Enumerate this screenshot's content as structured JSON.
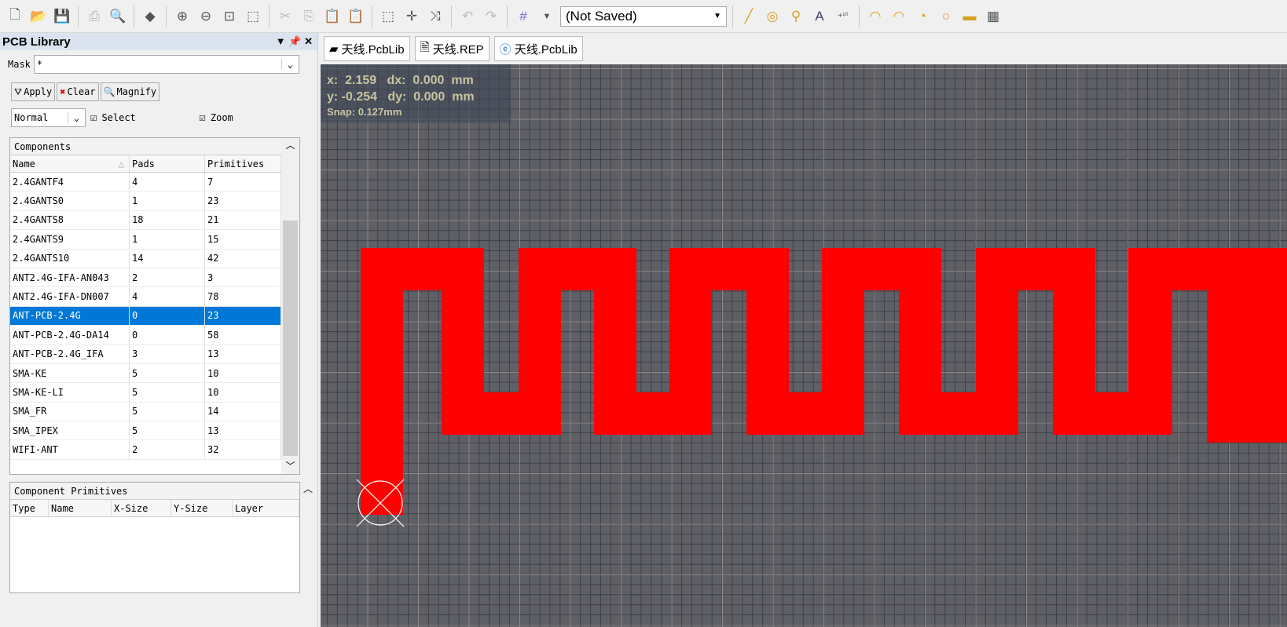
{
  "toolbar": {
    "snapshot_select": "(Not Saved)"
  },
  "panel": {
    "title": "PCB Library",
    "mask_label": "Mask",
    "mask_value": "*",
    "apply": "Apply",
    "clear": "Clear",
    "magnify": "Magnify",
    "mode": "Normal",
    "select": "Select",
    "zoom": "Zoom",
    "components_title": "Components",
    "columns": [
      "Name",
      "Pads",
      "Primitives"
    ],
    "rows": [
      [
        "2.4GANTF4",
        "4",
        "7"
      ],
      [
        "2.4GANTS0",
        "1",
        "23"
      ],
      [
        "2.4GANTS8",
        "18",
        "21"
      ],
      [
        "2.4GANTS9",
        "1",
        "15"
      ],
      [
        "2.4GANTS10",
        "14",
        "42"
      ],
      [
        "ANT2.4G-IFA-AN043",
        "2",
        "3"
      ],
      [
        "ANT2.4G-IFA-DN007",
        "4",
        "78"
      ],
      [
        "ANT-PCB-2.4G",
        "0",
        "23"
      ],
      [
        "ANT-PCB-2.4G-DA14",
        "0",
        "58"
      ],
      [
        "ANT-PCB-2.4G_IFA",
        "3",
        "13"
      ],
      [
        "SMA-KE",
        "5",
        "10"
      ],
      [
        "SMA-KE-LI",
        "5",
        "10"
      ],
      [
        "SMA_FR",
        "5",
        "14"
      ],
      [
        "SMA_IPEX",
        "5",
        "13"
      ],
      [
        "WIFI-ANT",
        "2",
        "32"
      ]
    ],
    "primitives_title": "Component Primitives",
    "prim_columns": [
      "Type",
      "Name",
      "X-Size",
      "Y-Size",
      "Layer"
    ]
  },
  "tabs": [
    "天线.PcbLib",
    "天线.REP",
    "天线.PcbLib"
  ],
  "hud": {
    "x": "x:  2.159   dx:  0.000  mm",
    "y": "y: -0.254   dy:  0.000  mm",
    "snap": "Snap: 0.127mm"
  },
  "colors": {
    "track": "#ff0000",
    "selection": "#0078d7"
  }
}
